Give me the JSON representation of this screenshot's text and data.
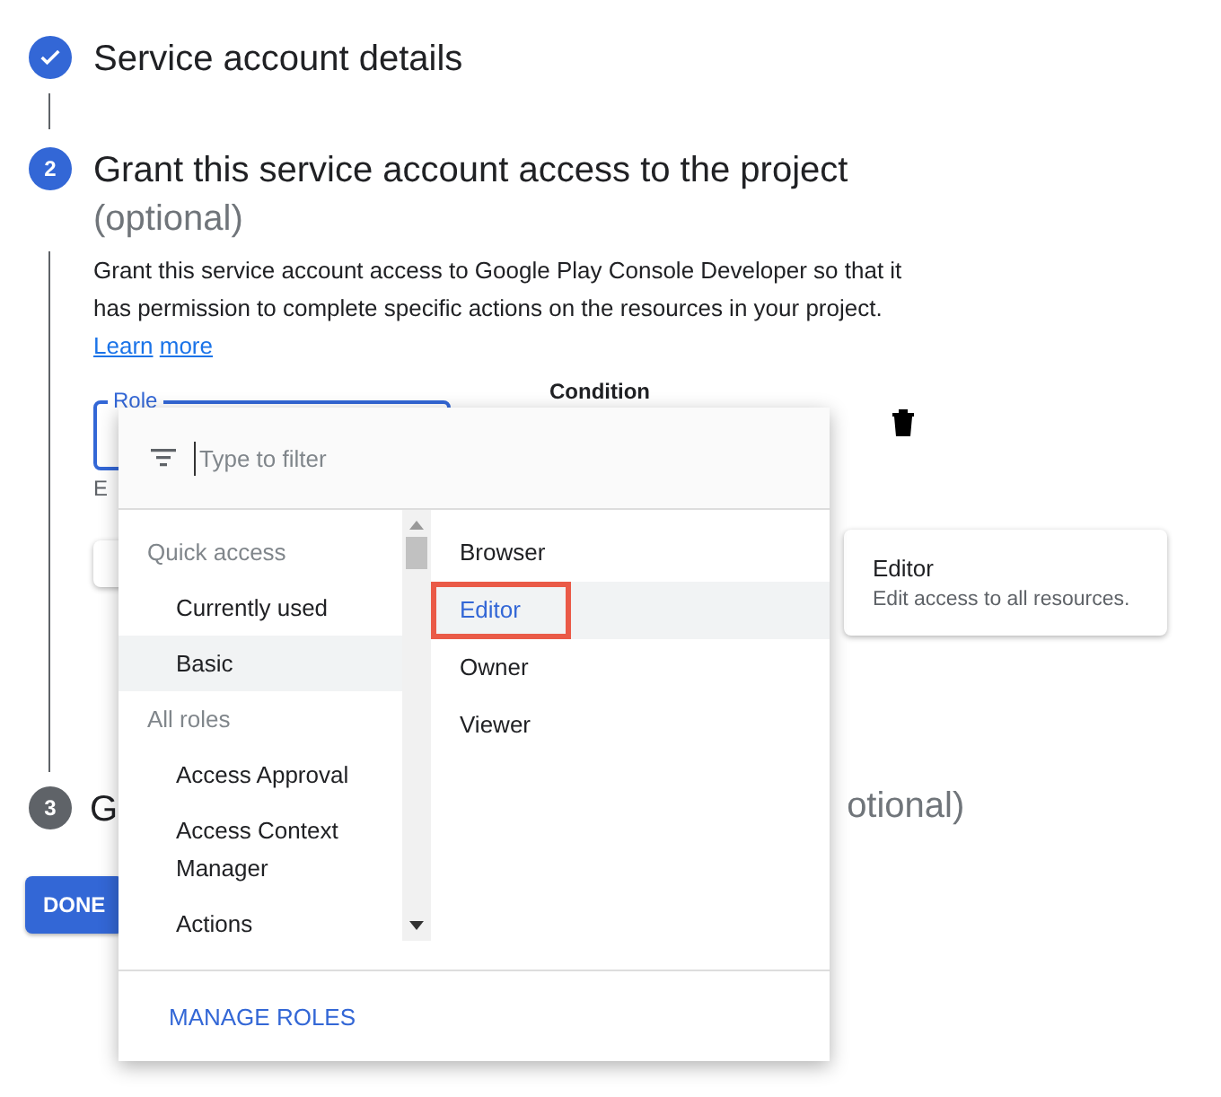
{
  "steps": [
    {
      "kind": "done",
      "title": "Service account details"
    },
    {
      "kind": "active",
      "number": "2",
      "title": "Grant this service account access to the project",
      "optional": "(optional)",
      "description": "Grant this service account access to Google Play Console Developer so that it has permission to complete specific actions on the resources in your project.",
      "link": "Learn more"
    },
    {
      "kind": "pending",
      "number": "3",
      "title": "G",
      "title_tail": "otional)"
    }
  ],
  "role_field": {
    "label": "Role",
    "helper": "E"
  },
  "condition": {
    "label": "Condition"
  },
  "role_card": {
    "title": "Editor",
    "description": "Edit access to all resources."
  },
  "done_button": "DONE",
  "dropdown": {
    "placeholder": "Type to filter",
    "categories": [
      {
        "kind": "header",
        "label": "Quick access",
        "selected": false
      },
      {
        "kind": "item",
        "label": "Currently used",
        "selected": false
      },
      {
        "kind": "item",
        "label": "Basic",
        "selected": true
      },
      {
        "kind": "header",
        "label": "All roles",
        "selected": false
      },
      {
        "kind": "item",
        "label": "Access Approval",
        "selected": false
      },
      {
        "kind": "item",
        "label": "Access Context Manager",
        "selected": false
      },
      {
        "kind": "item",
        "label": "Actions",
        "selected": false
      }
    ],
    "roles": [
      {
        "label": "Browser",
        "selected": false,
        "highlighted": false
      },
      {
        "label": "Editor",
        "selected": true,
        "highlighted": true
      },
      {
        "label": "Owner",
        "selected": false,
        "highlighted": false
      },
      {
        "label": "Viewer",
        "selected": false,
        "highlighted": false
      }
    ],
    "manage_link": "MANAGE ROLES"
  }
}
